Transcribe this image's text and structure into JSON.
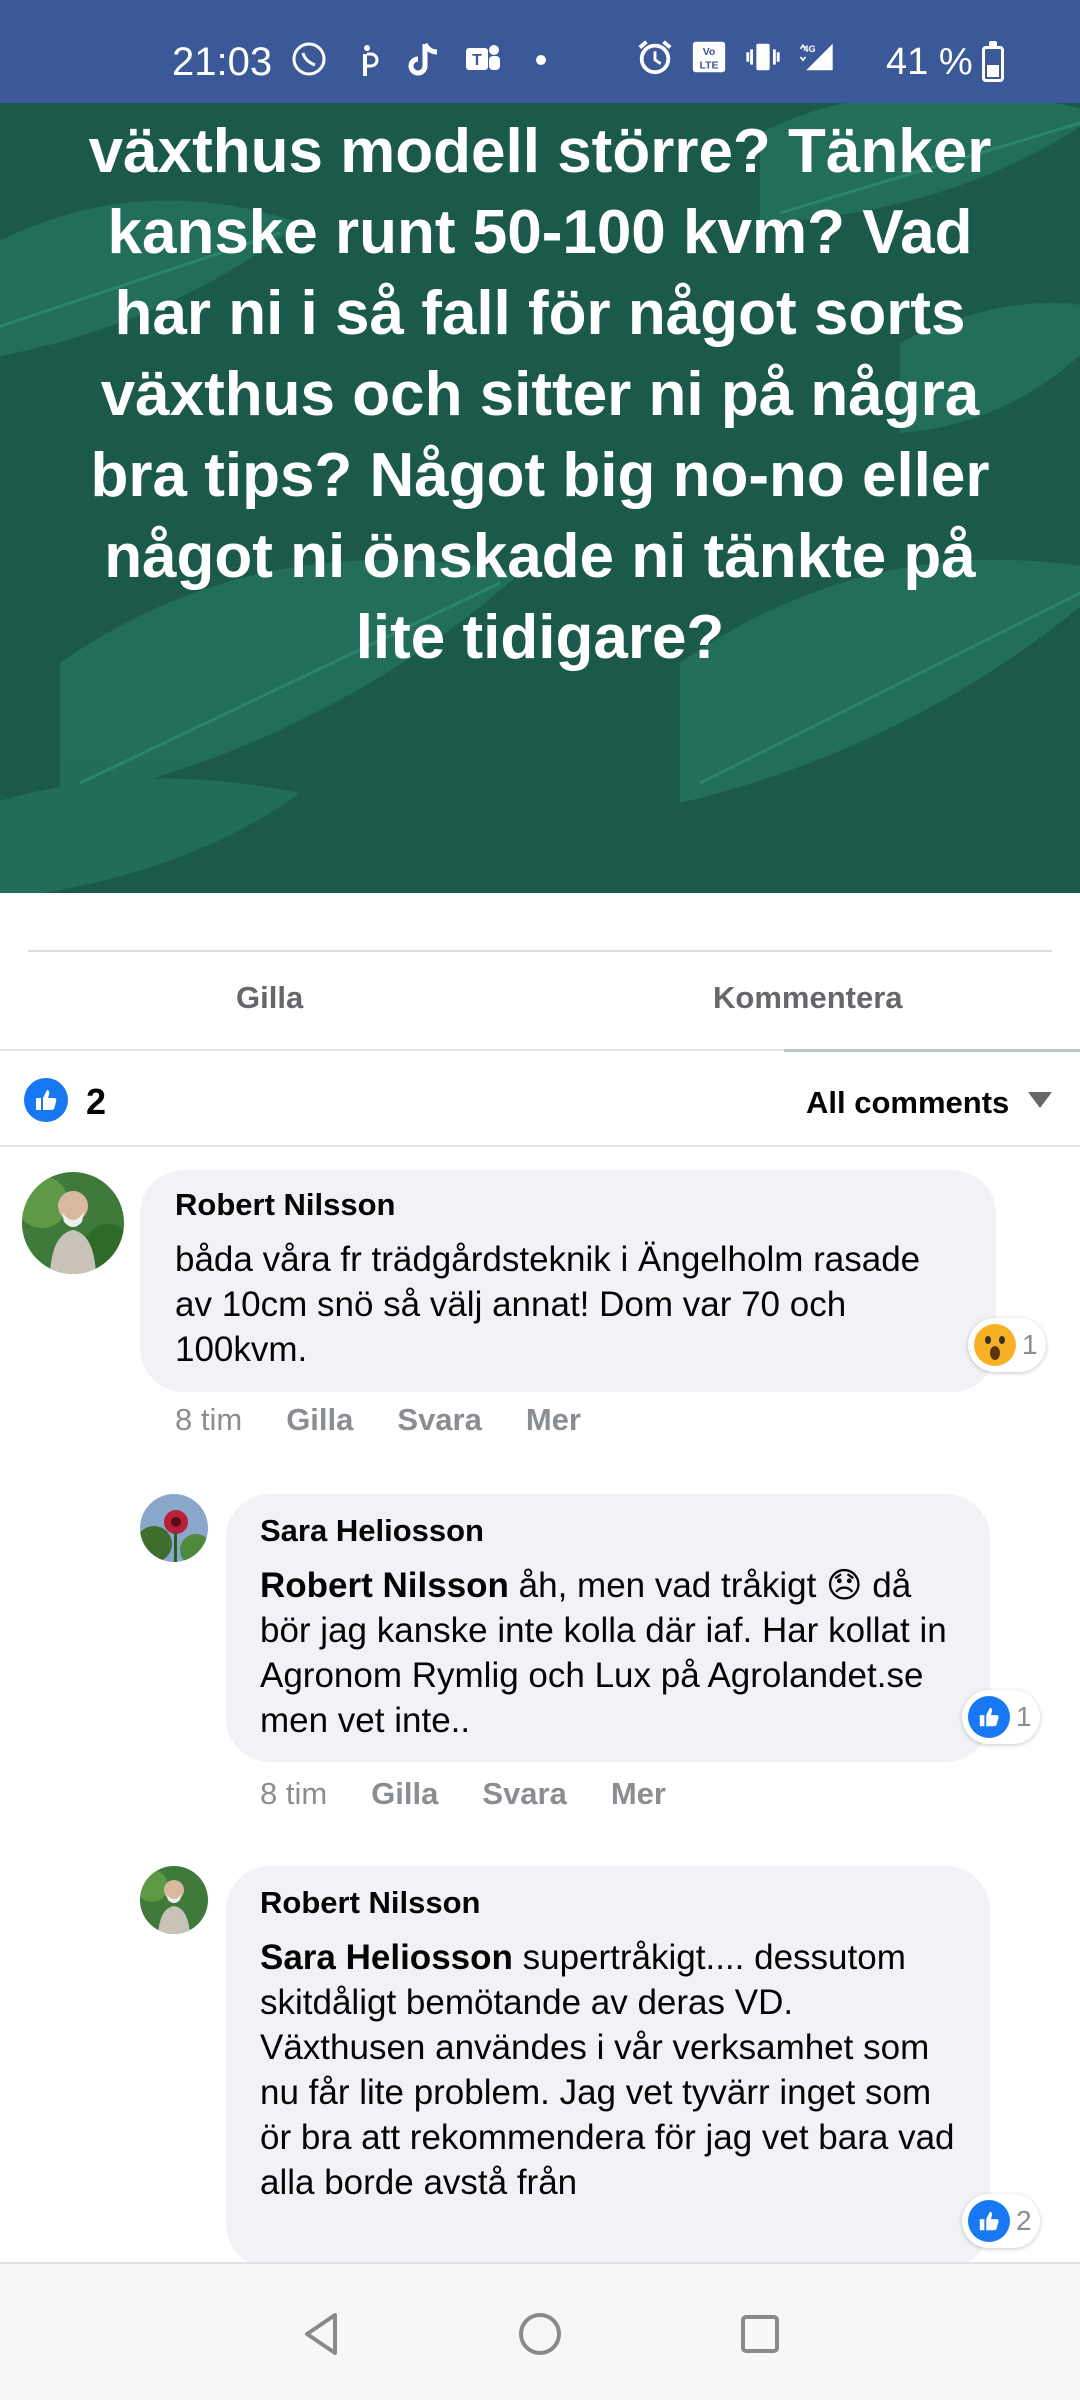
{
  "status_bar": {
    "time": "21:03",
    "battery": "41 %",
    "icons_left": [
      "whatsapp-icon",
      "p-icon",
      "tiktok-icon",
      "teams-icon",
      "dot-icon"
    ],
    "icons_right": [
      "alarm-icon",
      "volte-icon",
      "vibrate-icon",
      "signal-4g-icon"
    ]
  },
  "post": {
    "text": "växthus modell större? Tänker kanske runt 50-100 kvm? Vad har ni i så fall för något sorts växthus och sitter ni på några bra tips? Något big no-no eller något ni önskade ni tänkte på lite tidigare?",
    "background_color": "#1b5a4a"
  },
  "actions": {
    "like_label": "Gilla",
    "comment_label": "Kommentera"
  },
  "reactions": {
    "count": "2",
    "filter_label": "All comments"
  },
  "comments": [
    {
      "author": "Robert Nilsson",
      "mention": "",
      "text": "båda våra fr trädgårdsteknik i Ängelholm rasade av 10cm snö så välj annat! Dom var 70 och 100kvm.",
      "time": "8 tim",
      "like": "Gilla",
      "reply": "Svara",
      "more": "Mer",
      "reaction_count": "1",
      "reaction_type": "wow"
    },
    {
      "author": "Sara Heliosson",
      "mention": "Robert Nilsson",
      "text": "åh, men vad tråkigt 😞 då bör jag kanske inte kolla där iaf. Har kollat in Agronom Rymlig och Lux på Agrolandet.se men vet inte..",
      "time": "8 tim",
      "like": "Gilla",
      "reply": "Svara",
      "more": "Mer",
      "reaction_count": "1",
      "reaction_type": "like"
    },
    {
      "author": "Robert Nilsson",
      "mention": "Sara Heliosson",
      "text": "supertråkigt.... dessutom skitdåligt bemötande av deras VD. Växthusen användes i vår verksamhet som nu får lite problem. Jag vet tyvärr inget som ör bra att rekommendera för jag vet bara vad alla borde avstå från",
      "reaction_count": "2",
      "reaction_type": "like"
    }
  ],
  "nav": [
    "back-icon",
    "home-icon",
    "recents-icon"
  ]
}
